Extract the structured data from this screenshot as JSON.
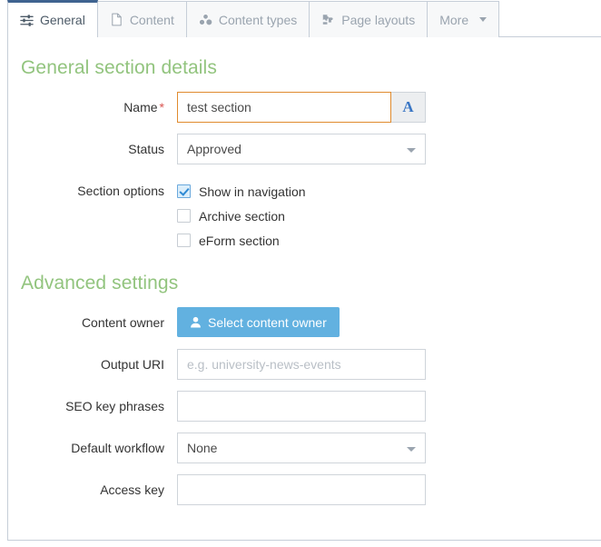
{
  "tabs": [
    {
      "label": "General",
      "icon": "sliders-icon",
      "active": true
    },
    {
      "label": "Content",
      "icon": "document-icon",
      "active": false
    },
    {
      "label": "Content types",
      "icon": "cubes-icon",
      "active": false
    },
    {
      "label": "Page layouts",
      "icon": "puzzle-piece-icon",
      "active": false
    },
    {
      "label": "More",
      "icon": "chevron-down-icon",
      "active": false
    }
  ],
  "general_section": {
    "heading": "General section details",
    "name": {
      "label": "Name",
      "required_marker": "*",
      "value": "test section",
      "addon_label": "A"
    },
    "status": {
      "label": "Status",
      "value": "Approved"
    },
    "section_options": {
      "label": "Section options",
      "options": [
        {
          "label": "Show in navigation",
          "checked": true
        },
        {
          "label": "Archive section",
          "checked": false
        },
        {
          "label": "eForm section",
          "checked": false
        }
      ]
    }
  },
  "advanced_section": {
    "heading": "Advanced settings",
    "content_owner": {
      "label": "Content owner",
      "button_label": "Select content owner"
    },
    "output_uri": {
      "label": "Output URI",
      "value": "",
      "placeholder": "e.g. university-news-events"
    },
    "seo_key_phrases": {
      "label": "SEO key phrases",
      "value": "",
      "placeholder": ""
    },
    "default_workflow": {
      "label": "Default workflow",
      "value": "None"
    },
    "access_key": {
      "label": "Access key",
      "value": "",
      "placeholder": ""
    }
  },
  "colors": {
    "heading_green": "#92c47e",
    "active_tab_border": "#3f6390",
    "focus_orange": "#e08b2e",
    "primary_blue": "#62b1e0",
    "required_red": "#d9534f",
    "addon_blue": "#3a76c4"
  }
}
